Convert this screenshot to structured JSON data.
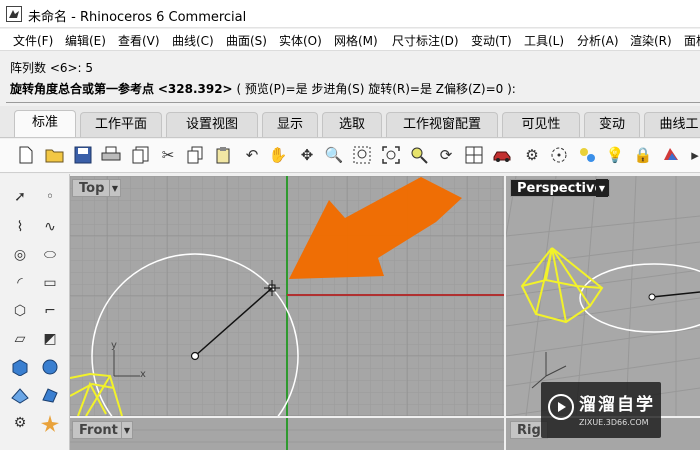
{
  "window": {
    "title": "未命名 - Rhinoceros 6 Commercial"
  },
  "menu": [
    "文件(F)",
    "编辑(E)",
    "查看(V)",
    "曲线(C)",
    "曲面(S)",
    "实体(O)",
    "网格(M)",
    "尺寸标注(D)",
    "变动(T)",
    "工具(L)",
    "分析(A)",
    "渲染(R)",
    "面板"
  ],
  "command": {
    "history": "阵列数 <6>: 5",
    "prompt_main": "旋转角度总合或第一参考点",
    "prompt_value": "<328.392>",
    "prompt_options": "( 预览(P)=是  步进角(S)  旋转(R)=是  Z偏移(Z)=0 ):"
  },
  "tabs": [
    "标准",
    "工作平面",
    "设置视图",
    "显示",
    "选取",
    "工作视窗配置",
    "可见性",
    "变动",
    "曲线工"
  ],
  "active_tab": "标准",
  "toolbar_icons": [
    "new-icon",
    "open-icon",
    "save-icon",
    "print-icon",
    "import-icon",
    "cut-icon",
    "copy-icon",
    "paste-icon",
    "undo-icon",
    "pan-icon",
    "rotate-view-icon",
    "zoom-icon",
    "zoom-window-icon",
    "zoom-extents-icon",
    "zoom-selected-icon",
    "rotate-icon",
    "grid-icon",
    "car-icon",
    "gear-icon",
    "circle-tool-icon",
    "lightbulb-icon",
    "lock-icon",
    "color-icon"
  ],
  "viewports": {
    "top": {
      "label": "Top",
      "axis_x": "x",
      "axis_y": "y"
    },
    "perspective": {
      "label": "Perspective"
    },
    "front": {
      "label": "Front"
    },
    "right": {
      "label": "Rig"
    }
  },
  "colors": {
    "viewport_bg": "#a6a6a6",
    "grid": "#9b9b9b",
    "x_axis": "#b03030",
    "y_axis": "#2f9a2f",
    "arrow": "#f26c00",
    "selected": "#f2f22a"
  },
  "watermark": {
    "text": "溜溜自学",
    "url": "ZIXUE.3D66.COM"
  }
}
